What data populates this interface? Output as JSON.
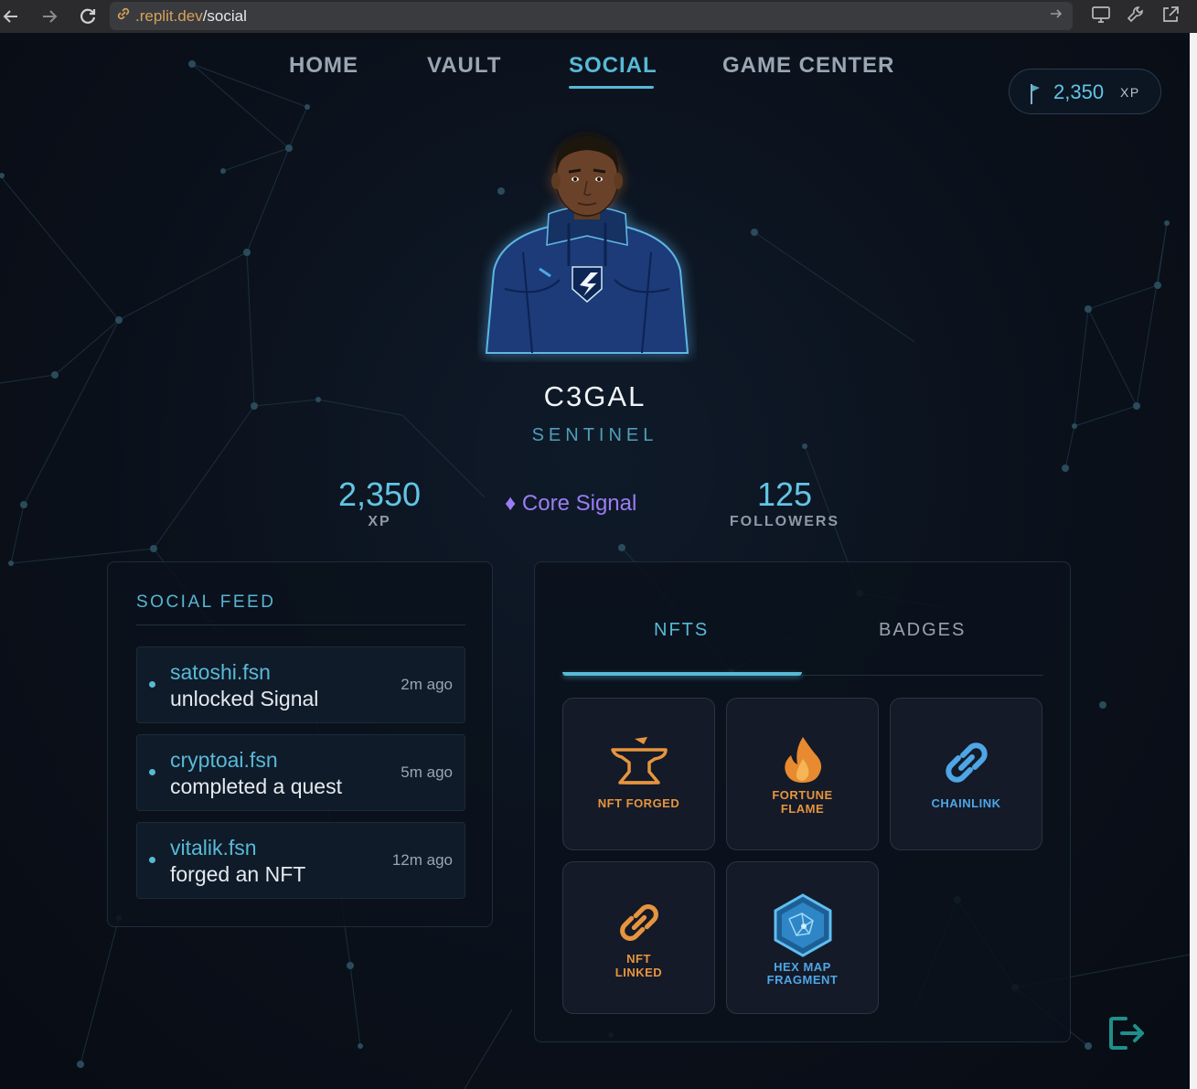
{
  "browser": {
    "url_host": ".replit.dev",
    "url_path": "/social"
  },
  "nav": {
    "items": [
      {
        "label": "HOME"
      },
      {
        "label": "VAULT"
      },
      {
        "label": "SOCIAL",
        "active": true
      },
      {
        "label": "GAME CENTER"
      }
    ]
  },
  "xp_pill": {
    "value": "2,350",
    "unit": "XP"
  },
  "profile": {
    "username": "C3GAL",
    "role": "SENTINEL",
    "xp_value": "2,350",
    "xp_label": "XP",
    "tier_icon": "♦",
    "tier_name": "Core Signal",
    "followers_value": "125",
    "followers_label": "FOLLOWERS"
  },
  "feed": {
    "title": "SOCIAL FEED",
    "items": [
      {
        "user": "satoshi.fsn",
        "action": "unlocked Signal",
        "time": "2m ago"
      },
      {
        "user": "cryptoai.fsn",
        "action": "completed a quest",
        "time": "5m ago"
      },
      {
        "user": "vitalik.fsn",
        "action": "forged an NFT",
        "time": "12m ago"
      }
    ]
  },
  "collection": {
    "tabs": [
      {
        "label": "NFTS",
        "active": true
      },
      {
        "label": "BADGES"
      }
    ],
    "tiles": [
      {
        "icon": "anvil-icon",
        "label_1": "NFT FORGED",
        "label_2": "",
        "color": "#e6953e"
      },
      {
        "icon": "flame-icon",
        "label_1": "FORTUNE",
        "label_2": "FLAME",
        "color": "#e6953e"
      },
      {
        "icon": "chain-link-icon",
        "label_1": "CHAINLINK",
        "label_2": "",
        "color": "#4ea6e6"
      },
      {
        "icon": "link-icon",
        "label_1": "NFT",
        "label_2": "LINKED",
        "color": "#e6953e"
      },
      {
        "icon": "hex-map-icon",
        "label_1": "HEX MAP",
        "label_2": "FRAGMENT",
        "color": "#4ea6e6"
      }
    ]
  },
  "colors": {
    "accent": "#57b9d6",
    "tier": "#9c7cf5",
    "orange": "#e6953e",
    "blue": "#4ea6e6",
    "background": "#0a0f18"
  }
}
